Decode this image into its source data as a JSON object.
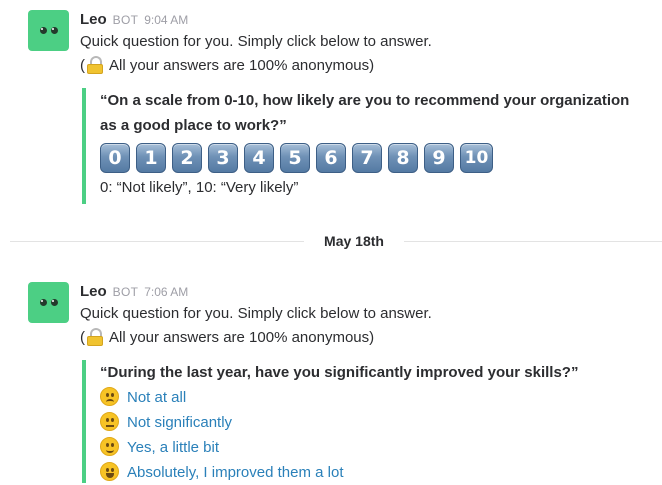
{
  "messages": [
    {
      "sender": "Leo",
      "badge": "BOT",
      "time": "9:04 AM",
      "intro": "Quick question for you. Simply click below to answer.",
      "anon_open": "(",
      "anon_text": "All your answers are 100% anonymous)",
      "question": "“On a scale from 0-10, how likely are you to recommend your organization as a good place to work?”",
      "scale_buttons": [
        "0",
        "1",
        "2",
        "3",
        "4",
        "5",
        "6",
        "7",
        "8",
        "9",
        "10"
      ],
      "scale_hint": "0: “Not likely”, 10: “Very likely”"
    },
    {
      "sender": "Leo",
      "badge": "BOT",
      "time": "7:06 AM",
      "intro": "Quick question for you. Simply click below to answer.",
      "anon_open": "(",
      "anon_text": "All your answers are 100% anonymous)",
      "question": "“During the last year, have you significantly improved your skills?”",
      "options": [
        {
          "label": "Not at all",
          "icon": "frowning-face-icon"
        },
        {
          "label": "Not significantly",
          "icon": "neutral-face-icon"
        },
        {
          "label": "Yes, a little bit",
          "icon": "slightly-smiling-face-icon"
        },
        {
          "label": "Absolutely, I improved them a lot",
          "icon": "grinning-face-icon"
        }
      ]
    }
  ],
  "date_divider": "May 18th",
  "colors": {
    "accent_green": "#4ccf84",
    "link_blue": "#2a80b9",
    "button_blue": "#6f91b6"
  }
}
